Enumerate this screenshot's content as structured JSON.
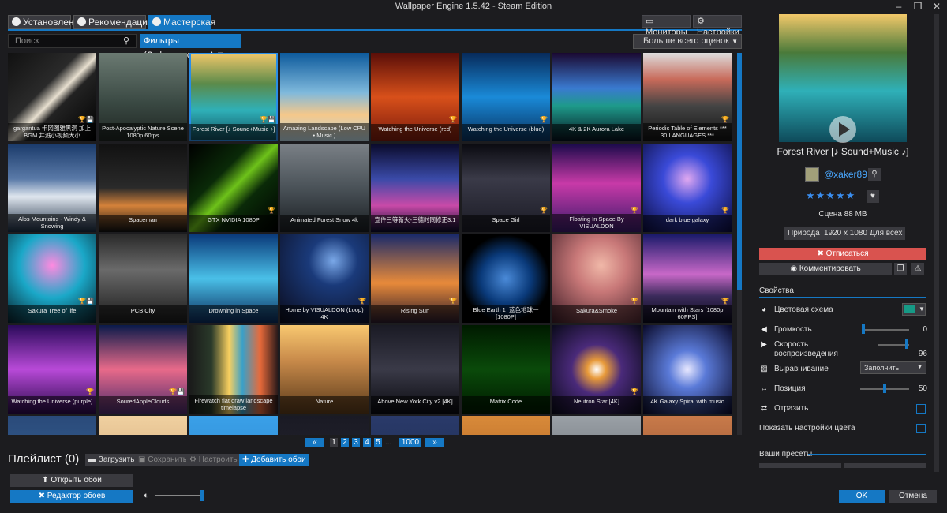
{
  "window": {
    "title": "Wallpaper Engine 1.5.42 - Steam Edition",
    "min": "–",
    "max": "❐",
    "close": "✕"
  },
  "tabs": [
    {
      "label": "Установлено"
    },
    {
      "label": "Рекомендации"
    },
    {
      "label": "Мастерская"
    }
  ],
  "top_buttons": {
    "monitors": "Мониторы",
    "settings": "Настройки"
  },
  "search": {
    "placeholder": "Поиск"
  },
  "filters": {
    "label": "Фильтры (Отфильтровано)"
  },
  "sort": {
    "value": "Больше всего оценок"
  },
  "grid": {
    "items": [
      {
        "title": "gargantua 卡冈图雅黑洞 加上BGM 井溅小视频大小",
        "bg": "linear-gradient(135deg,#111 0%,#2a2a2a 40%,#e8e0d0 52%,#222 60%,#000 100%)",
        "badge": "🏆💾"
      },
      {
        "title": "Post-Apocalyptic Nature Scene 1080p 60fps",
        "bg": "linear-gradient(180deg,#6b7a72 0%,#3b4a44 55%,#1d2420 100%)",
        "badge": ""
      },
      {
        "title": "Forest River [♪ Sound+Music ♪]",
        "bg": "linear-gradient(180deg,#f2c86a 0%,#5b8a4a 35%,#2fb0b8 65%,#0e4a5a 100%)",
        "badge": "🏆💾",
        "selected": true
      },
      {
        "title": "Amazing Landscape (Low CPU • Music )",
        "bg": "linear-gradient(180deg,#0d5a9c 0%,#7fb9dc 45%,#f5c88a 70%,#b7d3e0 100%)",
        "badge": ""
      },
      {
        "title": "Watching the Universe (red)",
        "bg": "linear-gradient(180deg,#5a0e08 0%,#d8501a 50%,#7a1a0c 100%)",
        "badge": "🏆"
      },
      {
        "title": "Watching the Universe (blue)",
        "bg": "linear-gradient(180deg,#072a5a 0%,#1a8ad8 50%,#08315e 100%)",
        "badge": "🏆"
      },
      {
        "title": "4K & 2K Aurora Lake",
        "bg": "linear-gradient(180deg,#1a0830 0%,#3a7ad0 40%,#1e9a8a 60%,#05101c 100%)",
        "badge": ""
      },
      {
        "title": "Periodic Table of Elements *** 30 LANGUAGES ***",
        "bg": "linear-gradient(180deg,#ddd 0%,#c86a5a 30%,#444 60%,#111 100%)",
        "badge": "🏆"
      },
      {
        "title": "Alps Mountains - Windy & Snowing",
        "bg": "linear-gradient(180deg,#1a3a6a 0%,#5a7aa8 40%,#dfe6ee 60%,#1a2a40 100%)",
        "badge": ""
      },
      {
        "title": "Spaceman",
        "bg": "linear-gradient(180deg,#111 0%,#2a2a2a 50%,#d4823a 70%,#111 100%)",
        "badge": ""
      },
      {
        "title": "GTX NVIDIA 1080P",
        "bg": "linear-gradient(135deg,#000 0%,#0a2a08 35%,#6ec21a 50%,#0a2a08 65%,#000 100%)",
        "badge": "🏆"
      },
      {
        "title": "Animated Forest Snow 4k",
        "bg": "linear-gradient(180deg,#7a8086 0%,#4a5258 50%,#1a1e22 100%)",
        "badge": ""
      },
      {
        "title": "宣件三等新火-三德时同修正3.1",
        "bg": "linear-gradient(180deg,#0a0a2a 0%,#3a4aa8 40%,#c84aa8 70%,#0a0a2a 100%)",
        "badge": ""
      },
      {
        "title": "Space Girl",
        "bg": "linear-gradient(180deg,#0a0a10 0%,#3a3a48 40%,#1a1a24 100%)",
        "badge": "🏆"
      },
      {
        "title": "Floating In Space By VISUALDON",
        "bg": "linear-gradient(180deg,#1a0a4a 0%,#c83aa8 45%,#3a1a6a 100%)",
        "badge": "🏆"
      },
      {
        "title": "dark blue galaxy",
        "bg": "radial-gradient(circle at 50% 40%,#e0a8f0 0%,#3a4ad8 35%,#0a0a3a 100%)",
        "badge": "🏆"
      },
      {
        "title": "Sakura Tree of life",
        "bg": "radial-gradient(circle at 50% 35%,#ff8ae0 0%,#1aa8c8 45%,#08202a 100%)",
        "badge": "🏆💾"
      },
      {
        "title": "PCB City",
        "bg": "linear-gradient(180deg,#2a2a2a 0%,#6a6a6a 40%,#1a1a1a 100%)",
        "badge": ""
      },
      {
        "title": "Drowning in Space",
        "bg": "linear-gradient(180deg,#0a3a7a 0%,#4ac0e8 50%,#0a2a5a 100%)",
        "badge": ""
      },
      {
        "title": "Home by VISUALDON (Loop) 4K",
        "bg": "radial-gradient(circle at 60% 30%,#7aa8e8 0%,#1a3a7a 30%,#0a0a1a 100%)",
        "badge": "🏆"
      },
      {
        "title": "Rising Sun",
        "bg": "linear-gradient(180deg,#1a2a6a 0%,#e88a3a 55%,#2a1a2a 100%)",
        "badge": "🏆"
      },
      {
        "title": "Blue Earth 1_蓝色地球一 [1080P]",
        "bg": "radial-gradient(circle at 50% 50%,#4a8ad8 0%,#0a3a7a 40%,#000 70%)",
        "badge": ""
      },
      {
        "title": "Sakura&Smoke",
        "bg": "radial-gradient(circle at 55% 35%,#f0b8a8 0%,#c87878 35%,#3a1a24 100%)",
        "badge": "🏆"
      },
      {
        "title": "Mountain with Stars [1080p 60FPS]",
        "bg": "linear-gradient(180deg,#1a1a6a 0%,#c868c8 45%,#3a2a5a 70%,#0a0a1a 100%)",
        "badge": "🏆"
      },
      {
        "title": "Watching the Universe (purple)",
        "bg": "linear-gradient(180deg,#2a0a5a 0%,#b84ad8 50%,#2a0a4a 100%)",
        "badge": "🏆"
      },
      {
        "title": "SouredAppleClouds",
        "bg": "linear-gradient(180deg,#0a1a4a 0%,#e86a8a 50%,#4a2a6a 100%)",
        "badge": "🏆💾"
      },
      {
        "title": "Firewatch flat draw landscape timelapse",
        "bg": "linear-gradient(90deg,#1a1a1a 0%,#2a3a2a 25%,#f8d060 45%,#3aa0c8 60%,#e86a3a 80%,#2a1a1a 100%)",
        "badge": ""
      },
      {
        "title": "Nature",
        "bg": "linear-gradient(180deg,#f8c870 0%,#c88a4a 40%,#5a3a1a 100%)",
        "badge": ""
      },
      {
        "title": "Above New York City v2 [4K]",
        "bg": "linear-gradient(180deg,#1a1a24 0%,#3a3a48 50%,#0a0a10 100%)",
        "badge": ""
      },
      {
        "title": "Matrix Code",
        "bg": "linear-gradient(180deg,#001a00 0%,#0a4a0a 50%,#001a00 100%)",
        "badge": ""
      },
      {
        "title": "Neutron Star [4K]",
        "bg": "radial-gradient(circle at 50% 50%,#fff 0%,#e89a3a 15%,#4a2a7a 40%,#0a0a1a 100%)",
        "badge": "🏆"
      },
      {
        "title": "4K Galaxy Spiral with music",
        "bg": "radial-gradient(circle at 50% 50%,#e8e8ff 0%,#5a7ad8 30%,#0a0a2a 100%)",
        "badge": ""
      },
      {
        "title": "",
        "bg": "linear-gradient(180deg,#2a4a7a 0%,#3a6a9a 100%)",
        "badge": ""
      },
      {
        "title": "",
        "bg": "linear-gradient(180deg,#f0d0a0 0%,#c8a070 100%)",
        "badge": ""
      },
      {
        "title": "",
        "bg": "linear-gradient(180deg,#3aa0e8 0%,#2a80c8 100%)",
        "badge": ""
      },
      {
        "title": "",
        "bg": "linear-gradient(180deg,#1a1a24 0%,#2a2a34 100%)",
        "badge": ""
      },
      {
        "title": "",
        "bg": "linear-gradient(180deg,#2a3a6a 0%,#1a2a4a 100%)",
        "badge": ""
      },
      {
        "title": "",
        "bg": "linear-gradient(180deg,#d88a3a 0%,#a85a1a 100%)",
        "badge": ""
      },
      {
        "title": "",
        "bg": "linear-gradient(180deg,#9aa0a6 0%,#5a6066 100%)",
        "badge": ""
      },
      {
        "title": "",
        "bg": "linear-gradient(180deg,#c87a4a 0%,#8a4a2a 100%)",
        "badge": ""
      }
    ]
  },
  "pagination": {
    "prev": "«",
    "pages": [
      "1",
      "2",
      "3",
      "4",
      "5"
    ],
    "ellipsis": "...",
    "last": "1000",
    "next": "»",
    "current": "1"
  },
  "playlist": {
    "title": "Плейлист (0)",
    "load": "Загрузить",
    "save": "Сохранить",
    "configure": "Настроить",
    "add": "Добавить обои"
  },
  "bottom": {
    "open": "Открыть обои",
    "editor": "Редактор обоев"
  },
  "details": {
    "title": "Forest River [♪ Sound+Music ♪]",
    "author": "@xaker89",
    "rating": 5,
    "stars": "★★★★★",
    "scene_info": "Сцена  88 MB",
    "tags": [
      "Природа",
      "1920 x 1080",
      "Для всех"
    ],
    "unsubscribe": "Отписаться",
    "comment": "Комментировать"
  },
  "properties": {
    "title": "Свойства",
    "color_scheme": {
      "label": "Цветовая схема",
      "color": "#169a86"
    },
    "volume": {
      "label": "Громкость",
      "value": "0",
      "fraction": 0.0
    },
    "speed": {
      "label": "Скорость воспроизведения",
      "value": "96",
      "fraction": 0.96
    },
    "align": {
      "label": "Выравнивание",
      "value": "Заполнить"
    },
    "position": {
      "label": "Позиция",
      "value": "50",
      "fraction": 0.5
    },
    "flip": {
      "label": "Отразить"
    },
    "show_colors": {
      "label": "Показать настройки цвета"
    }
  },
  "presets": {
    "title": "Ваши пресеты"
  },
  "actions": {
    "ok": "OK",
    "cancel": "Отмена"
  },
  "colors": {
    "accent": "#1578c4",
    "danger": "#d9534f",
    "link": "#4aa8ff"
  }
}
